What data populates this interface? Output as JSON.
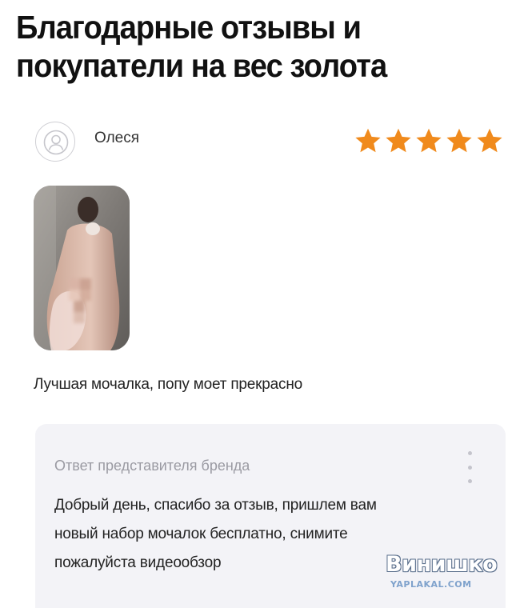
{
  "headline": {
    "line1": "Благодарные отзывы и",
    "line2": "покупатели на вес золота"
  },
  "review": {
    "reviewer_name": "Олеся",
    "rating": 5,
    "rating_max": 5,
    "star_color": "#f08a1c",
    "photo_blurred": true,
    "text": "Лучшая мочалка, попу моет прекрасно"
  },
  "brand_reply": {
    "label": "Ответ представителя бренда",
    "lines": [
      "Добрый день, спасибо за отзыв, пришлем вам",
      "новый набор мочалок бесплатно, снимите",
      "пожалуйста видеообзор"
    ],
    "menu_icon": "more-vertical-icon"
  },
  "watermark": {
    "main": "Винишко",
    "sub": "YAPLAKAL.COM"
  }
}
